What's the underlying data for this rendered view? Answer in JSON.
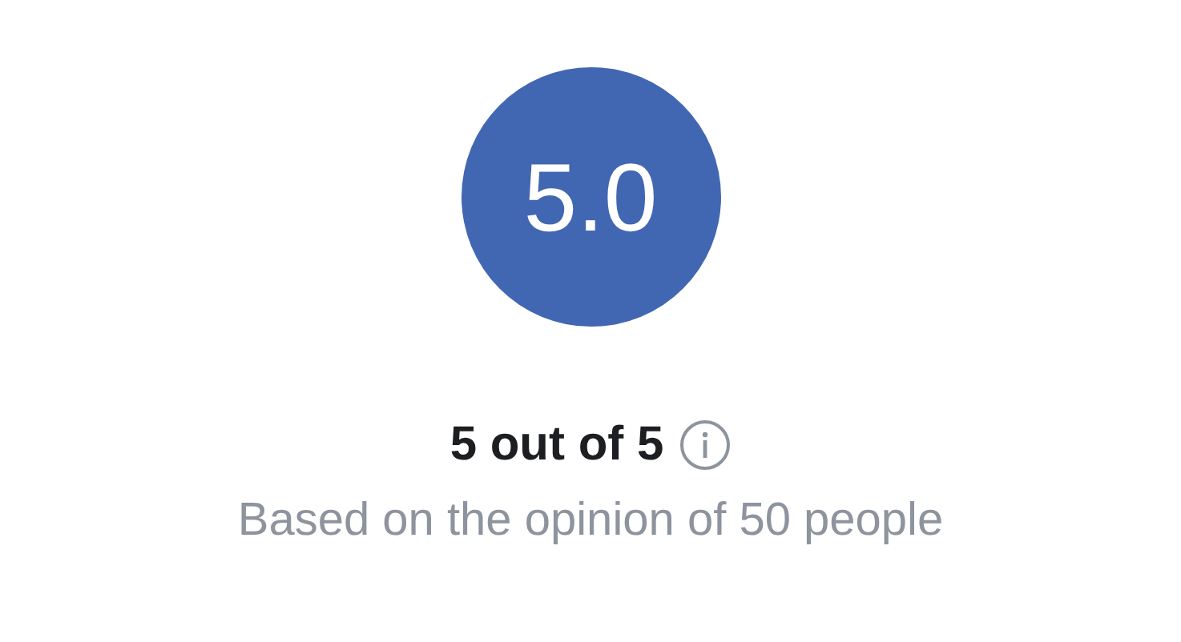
{
  "score": "5.0",
  "rating_text": "5 out of 5",
  "subtitle": "Based on the opinion of 50 people"
}
